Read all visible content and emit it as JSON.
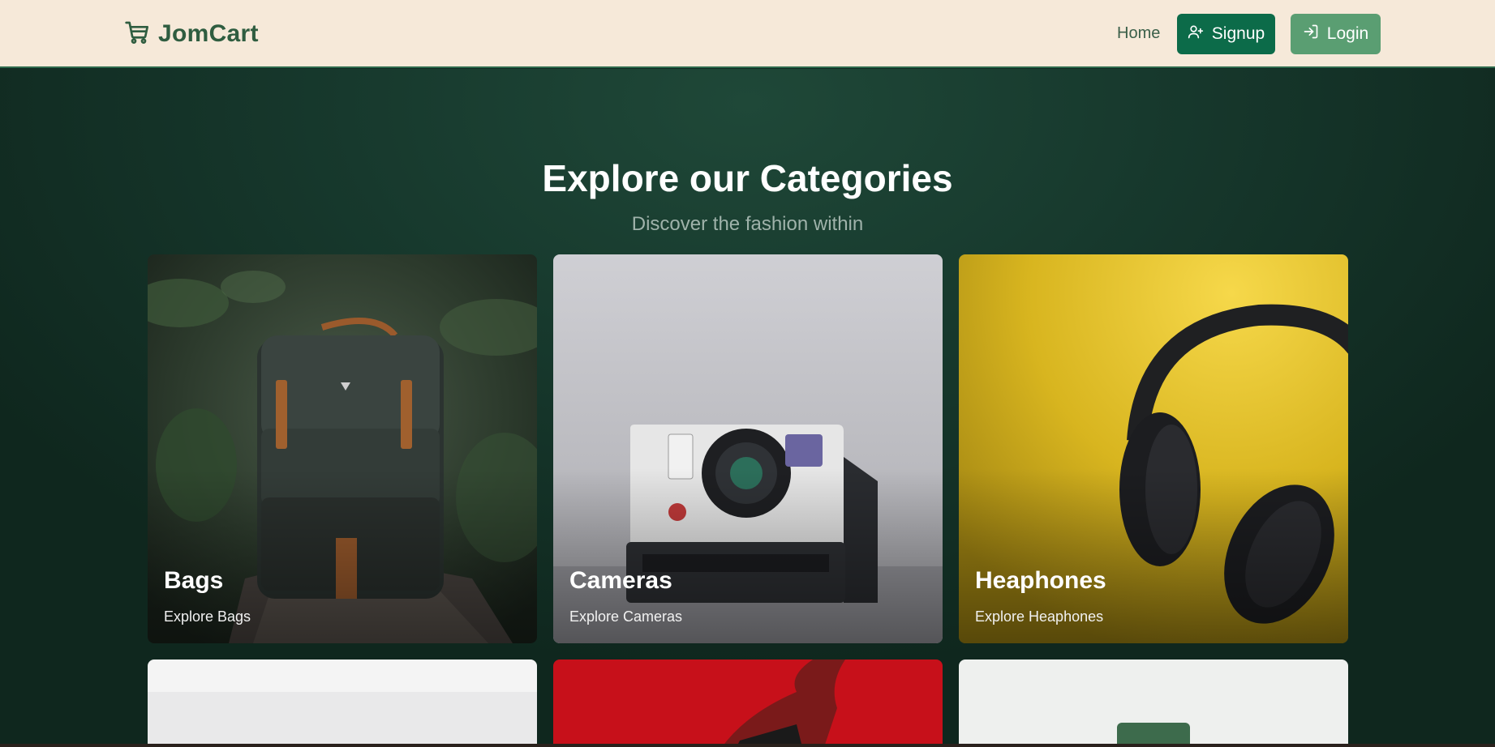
{
  "brand": {
    "name": "JomCart",
    "icon": "cart-icon"
  },
  "nav": {
    "home_label": "Home",
    "signup_label": "Signup",
    "login_label": "Login"
  },
  "hero": {
    "title": "Explore our Categories",
    "subtitle": "Discover the fashion within"
  },
  "categories": [
    {
      "title": "Bags",
      "link": "Explore Bags"
    },
    {
      "title": "Cameras",
      "link": "Explore Cameras"
    },
    {
      "title": "Heaphones",
      "link": "Explore Heaphones"
    },
    {
      "title": "",
      "link": ""
    },
    {
      "title": "",
      "link": ""
    },
    {
      "title": "",
      "link": ""
    }
  ],
  "colors": {
    "navbar_bg": "#f6e9d9",
    "brand": "#2f5d40",
    "signup_bg": "#0c6b49",
    "login_bg": "#5a9e72",
    "hero_bg": "#17392d"
  }
}
